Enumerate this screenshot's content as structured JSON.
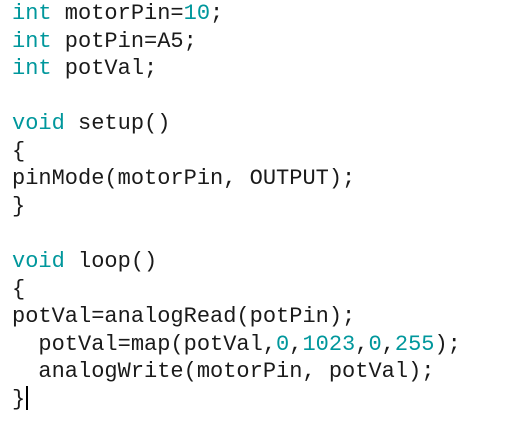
{
  "colors": {
    "background": "#ffffff",
    "text": "#1a1a1a",
    "keyword": "#00979c",
    "number": "#00979c"
  },
  "code": {
    "lines": [
      [
        {
          "t": "int",
          "k": "kw"
        },
        {
          "t": " motorPin="
        },
        {
          "t": "10",
          "k": "num"
        },
        {
          "t": ";"
        }
      ],
      [
        {
          "t": "int",
          "k": "kw"
        },
        {
          "t": " potPin=A5;"
        }
      ],
      [
        {
          "t": "int",
          "k": "kw"
        },
        {
          "t": " potVal;"
        }
      ],
      [],
      [
        {
          "t": "void",
          "k": "kw"
        },
        {
          "t": " setup()"
        }
      ],
      [
        {
          "t": "{"
        }
      ],
      [
        {
          "t": "pinMode(motorPin, OUTPUT);"
        }
      ],
      [
        {
          "t": "}"
        }
      ],
      [],
      [
        {
          "t": "void",
          "k": "kw"
        },
        {
          "t": " loop()"
        }
      ],
      [
        {
          "t": "{"
        }
      ],
      [
        {
          "t": "potVal=analogRead(potPin);"
        }
      ],
      [
        {
          "t": "  potVal=map(potVal,"
        },
        {
          "t": "0",
          "k": "num"
        },
        {
          "t": ","
        },
        {
          "t": "1023",
          "k": "num"
        },
        {
          "t": ","
        },
        {
          "t": "0",
          "k": "num"
        },
        {
          "t": ","
        },
        {
          "t": "255",
          "k": "num"
        },
        {
          "t": ");"
        }
      ],
      [
        {
          "t": "  analogWrite(motorPin, potVal);"
        }
      ],
      [
        {
          "t": "}"
        }
      ]
    ]
  }
}
